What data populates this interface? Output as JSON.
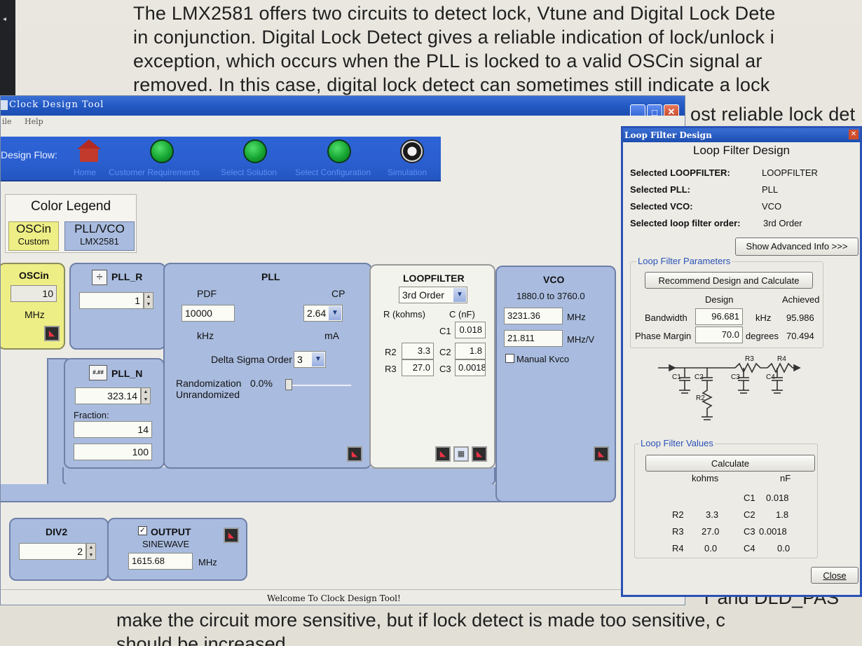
{
  "document": {
    "lines": [
      "The LMX2581 offers two circuits to detect lock, Vtune and Digital Lock Dete",
      "in conjunction. Digital Lock Detect gives a reliable indication of lock/unlock i",
      "exception, which occurs when the PLL is locked to a valid OSCin signal ar",
      "removed. In this case, digital lock detect can sometimes still indicate a lock",
      "ost reliable lock det"
    ],
    "bottom_lines": [
      "T and DLD_PAS",
      "make the circuit more sensitive, but if lock detect is made too sensitive, c",
      "should be increased"
    ]
  },
  "app": {
    "title": "Clock Design Tool",
    "menu": [
      "ile",
      "Help"
    ],
    "window_buttons": [
      "_",
      "□",
      "✕"
    ],
    "status": "Welcome To Clock Design Tool!"
  },
  "flow": {
    "label": "Design Flow:",
    "steps": [
      "Home",
      "Customer Requirements",
      "Select Solution",
      "Select Configuration",
      "Simulation"
    ]
  },
  "legend": {
    "title": "Color Legend",
    "oscin": {
      "name": "OSCin",
      "sub": "Custom",
      "color": "#eeee86"
    },
    "pllvco": {
      "name": "PLL/VCO",
      "sub": "LMX2581",
      "color": "#a9bcdf"
    }
  },
  "oscin": {
    "title": "OSCin",
    "value": "10",
    "unit": "MHz"
  },
  "pll_r": {
    "title": "PLL_R",
    "value": "1"
  },
  "pll_n": {
    "title": "PLL_N",
    "value": "323.14",
    "fraction_label": "Fraction:",
    "fraction_num": "14",
    "fraction_den": "100"
  },
  "pll": {
    "title": "PLL",
    "pdf_label": "PDF",
    "pdf_value": "10000",
    "pdf_unit": "kHz",
    "cp_label": "CP",
    "cp_value": "2.64",
    "cp_unit": "mA",
    "dso_label": "Delta Sigma Order",
    "dso_value": "3",
    "rand_label": "Randomization",
    "rand_value": "0.0%",
    "rand_state": "Unrandomized"
  },
  "loopfilter": {
    "title": "LOOPFILTER",
    "order": "3rd Order",
    "r_header": "R (kohms)",
    "c_header": "C (nF)",
    "c1_label": "C1",
    "c1": "0.018",
    "r2_label": "R2",
    "r2": "3.3",
    "c2_label": "C2",
    "c2": "1.8",
    "r3_label": "R3",
    "r3": "27.0",
    "c3_label": "C3",
    "c3": "0.0018"
  },
  "vco": {
    "title": "VCO",
    "range": "1880.0 to 3760.0",
    "freq": "3231.36",
    "freq_unit": "MHz",
    "kvco": "21.811",
    "kvco_unit": "MHz/V",
    "manual_label": "Manual Kvco"
  },
  "div2": {
    "title": "DIV2",
    "value": "2"
  },
  "output": {
    "title": "OUTPUT",
    "mode": "SINEWAVE",
    "freq": "1615.68",
    "unit": "MHz"
  },
  "dialog": {
    "title": "Loop Filter Design",
    "heading": "Loop Filter Design",
    "sel_lf_label": "Selected LOOPFILTER:",
    "sel_lf": "LOOPFILTER",
    "sel_pll_label": "Selected PLL:",
    "sel_pll": "PLL",
    "sel_vco_label": "Selected VCO:",
    "sel_vco": "VCO",
    "sel_order_label": "Selected loop filter order:",
    "sel_order": "3rd Order",
    "advanced_btn": "Show Advanced Info >>>",
    "params_title": "Loop Filter Parameters",
    "recommend_btn": "Recommend Design and Calculate",
    "design_hdr": "Design",
    "achieved_hdr": "Achieved",
    "bw_label": "Bandwidth",
    "bw_design": "96.681",
    "bw_unit": "kHz",
    "bw_achieved": "95.986",
    "pm_label": "Phase Margin",
    "pm_design": "70.0",
    "pm_unit": "degrees",
    "pm_achieved": "70.494",
    "schematic_labels": [
      "R3",
      "R4",
      "C1",
      "C2",
      "C3",
      "C4",
      "R2"
    ],
    "values_title": "Loop Filter Values",
    "calc_btn": "Calculate",
    "kohms_hdr": "kohms",
    "nf_hdr": "nF",
    "vals": [
      {
        "r_label": "",
        "r": "",
        "c_label": "C1",
        "c": "0.018"
      },
      {
        "r_label": "R2",
        "r": "3.3",
        "c_label": "C2",
        "c": "1.8"
      },
      {
        "r_label": "R3",
        "r": "27.0",
        "c_label": "C3",
        "c": "0.0018"
      },
      {
        "r_label": "R4",
        "r": "0.0",
        "c_label": "C4",
        "c": "0.0"
      }
    ],
    "close_btn": "Close"
  }
}
